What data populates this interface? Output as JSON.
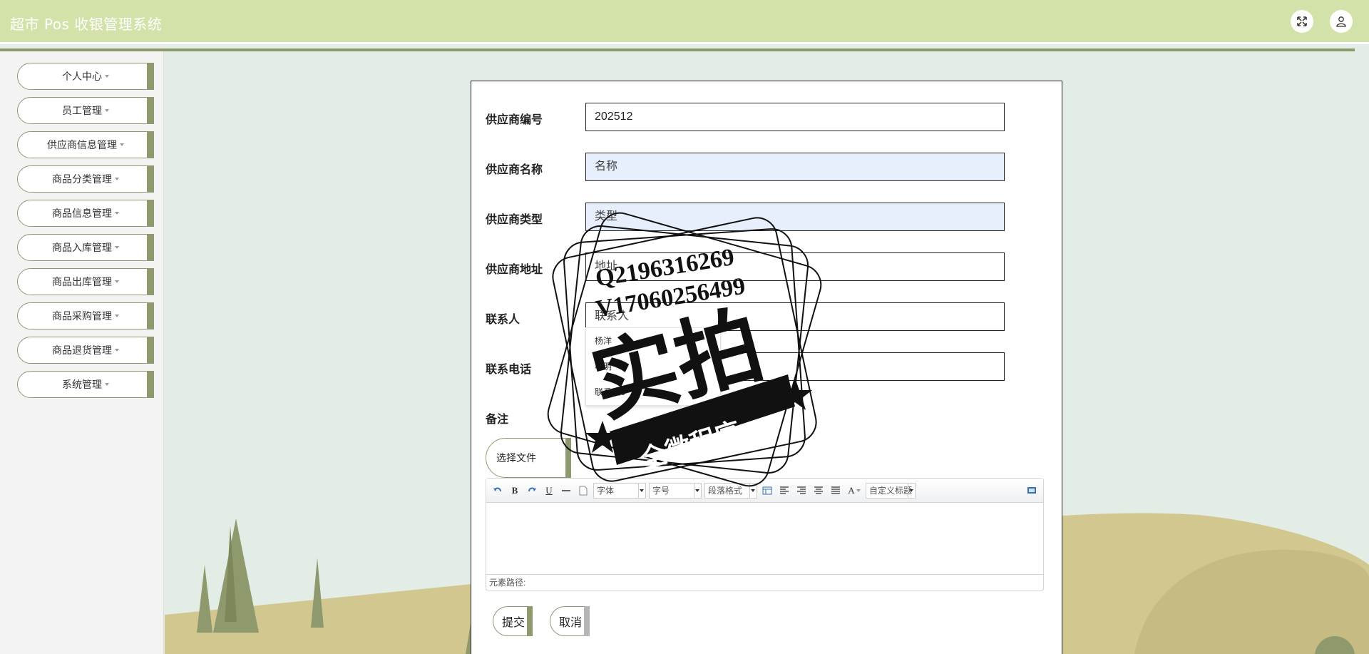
{
  "header": {
    "title": "超市 Pos 收银管理系统",
    "fullscreen_icon": "expand-icon",
    "user_icon": "user-icon"
  },
  "sidebar": {
    "items": [
      {
        "label": "个人中心"
      },
      {
        "label": "员工管理"
      },
      {
        "label": "供应商信息管理"
      },
      {
        "label": "商品分类管理"
      },
      {
        "label": "商品信息管理"
      },
      {
        "label": "商品入库管理"
      },
      {
        "label": "商品出库管理"
      },
      {
        "label": "商品采购管理"
      },
      {
        "label": "商品退货管理"
      },
      {
        "label": "系统管理"
      }
    ]
  },
  "form": {
    "code": {
      "label": "供应商编号",
      "value": "202512"
    },
    "name": {
      "label": "供应商名称",
      "placeholder": "名称"
    },
    "type": {
      "label": "供应商类型",
      "placeholder": "类型"
    },
    "address": {
      "label": "供应商地址",
      "placeholder": "地址"
    },
    "contact": {
      "label": "联系人",
      "placeholder": "联系人"
    },
    "phone": {
      "label": "联系电话",
      "placeholder": ""
    },
    "remark": {
      "label": "备注"
    },
    "autocomplete": [
      "杨洋",
      "小明",
      "联系人6"
    ],
    "file_button": "选择文件",
    "editor": {
      "font_family": "字体",
      "font_size": "字号",
      "paragraph": "段落格式",
      "custom_title": "自定义标题",
      "path_label": "元素路径:"
    },
    "submit": "提交",
    "cancel": "取消"
  },
  "watermark": {
    "line1": "Q2196316269",
    "line2": "V17060256499",
    "big": "实拍",
    "banner": "全微程序"
  },
  "colors": {
    "header": "#d3e2a9",
    "accent": "#8e9a6d",
    "background": "#e3ede6",
    "filled_input": "#e6effb"
  }
}
